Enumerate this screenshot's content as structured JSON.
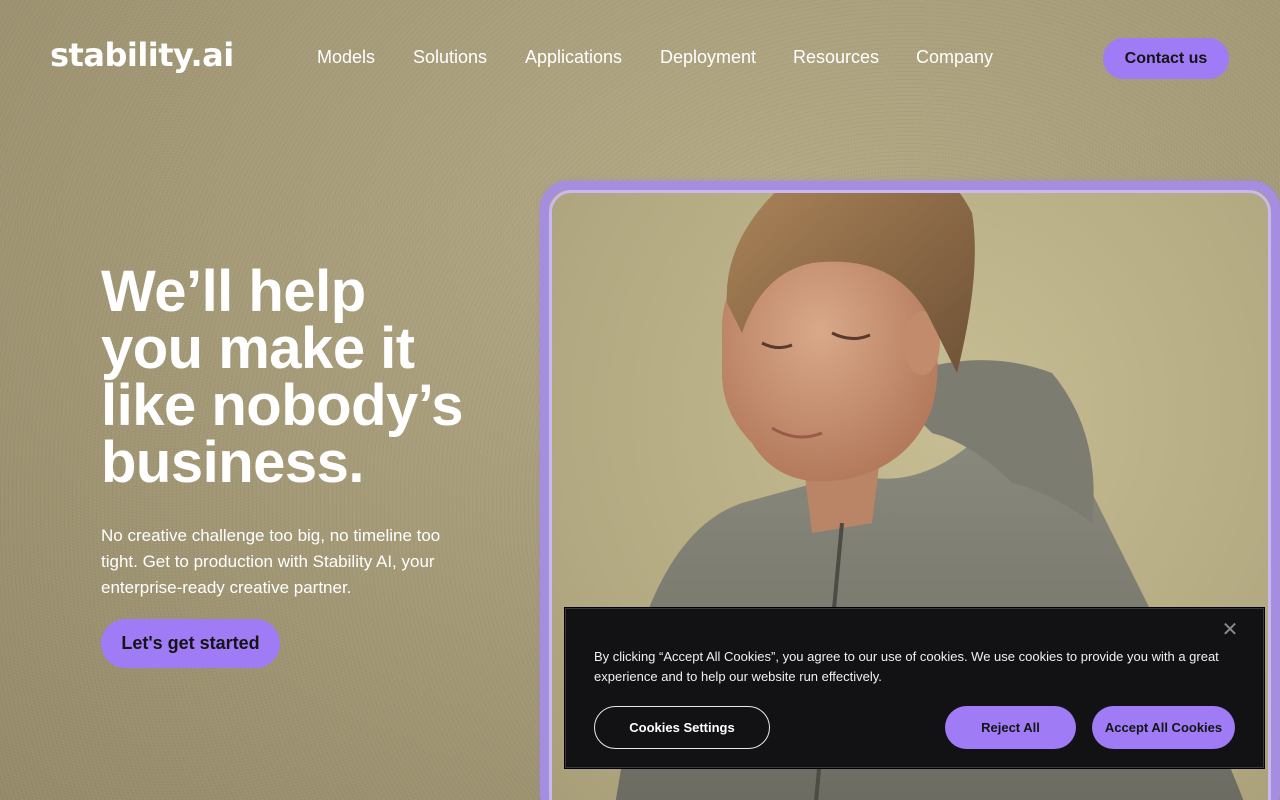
{
  "header": {
    "logo": "stability.ai",
    "nav": [
      {
        "label": "Models"
      },
      {
        "label": "Solutions"
      },
      {
        "label": "Applications"
      },
      {
        "label": "Deployment"
      },
      {
        "label": "Resources"
      },
      {
        "label": "Company"
      }
    ],
    "contact_label": "Contact us"
  },
  "hero": {
    "title_lines": [
      "We’ll help",
      "you make it",
      "like nobody’s",
      "business."
    ],
    "subtitle": "No creative challenge too big, no timeline too tight. Get to production with Stability AI, your enterprise-ready creative partner.",
    "cta_label": "Let's get started"
  },
  "cookie_banner": {
    "close_icon": "close-icon",
    "text": "By clicking “Accept All Cookies”, you agree to our use of cookies. We use cookies to provide you with a great experience and to help our website run effectively.",
    "settings_label": "Cookies Settings",
    "reject_label": "Reject All",
    "accept_label": "Accept All Cookies"
  },
  "colors": {
    "accent": "#9f7bf5",
    "background": "#a59a78",
    "banner_bg": "#121214"
  }
}
